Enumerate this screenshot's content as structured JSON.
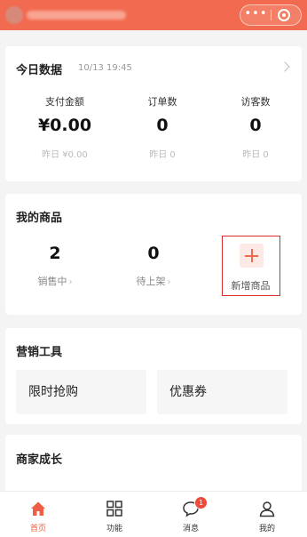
{
  "header": {},
  "today": {
    "title": "今日数据",
    "timestamp": "10/13 19:45",
    "stats": [
      {
        "label": "支付金额",
        "value": "¥0.00",
        "yesterday": "昨日 ¥0.00"
      },
      {
        "label": "订单数",
        "value": "0",
        "yesterday": "昨日 0"
      },
      {
        "label": "访客数",
        "value": "0",
        "yesterday": "昨日 0"
      }
    ]
  },
  "goods": {
    "title": "我的商品",
    "on_sale": {
      "count": "2",
      "label": "销售中"
    },
    "pending": {
      "count": "0",
      "label": "待上架"
    },
    "add_label": "新增商品",
    "arrow": "›"
  },
  "tools": {
    "title": "营销工具",
    "items": [
      "限时抢购",
      "优惠券"
    ]
  },
  "growth": {
    "title": "商家成长"
  },
  "tabbar": {
    "items": [
      {
        "label": "首页",
        "icon": "home-icon",
        "active": true
      },
      {
        "label": "功能",
        "icon": "grid-icon",
        "active": false
      },
      {
        "label": "消息",
        "icon": "message-icon",
        "active": false,
        "badge": "1"
      },
      {
        "label": "我的",
        "icon": "user-icon",
        "active": false
      }
    ],
    "accent": "#ee5f45"
  },
  "colors": {
    "header": "#f26a4f",
    "highlight_border": "#d92c2c"
  }
}
